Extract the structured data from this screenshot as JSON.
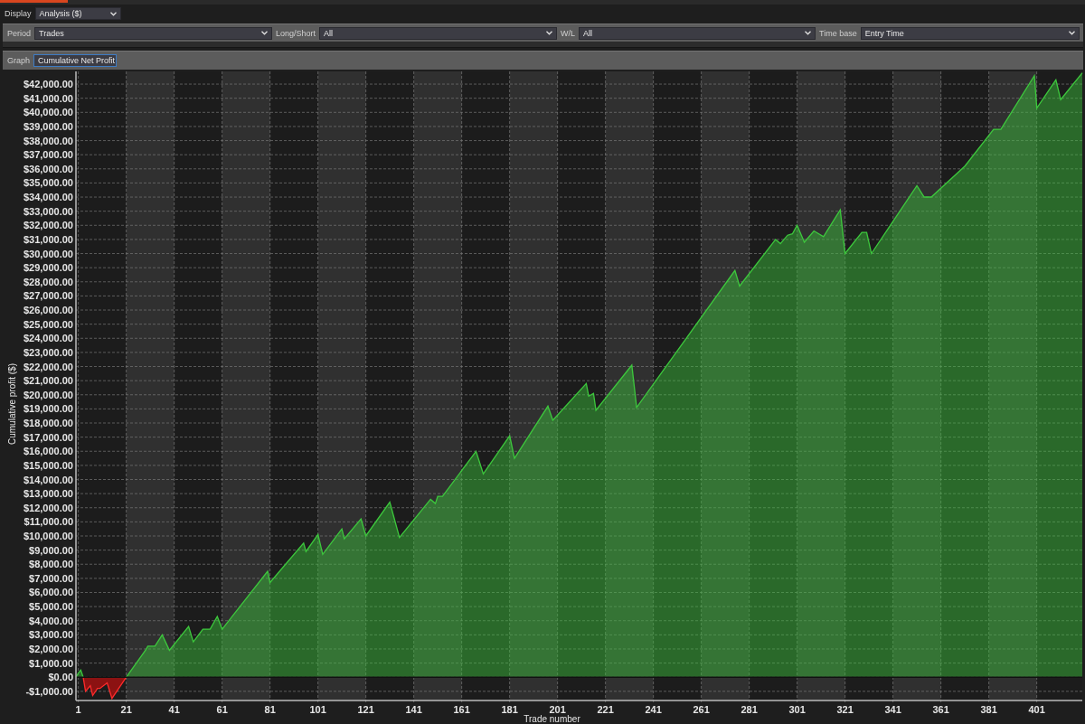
{
  "display": {
    "label": "Display",
    "value": "Analysis ($)"
  },
  "filters": [
    {
      "label": "Period",
      "value": "Trades"
    },
    {
      "label": "Long/Short",
      "value": "All"
    },
    {
      "label": "W/L",
      "value": "All"
    },
    {
      "label": "Time base",
      "value": "Entry Time"
    }
  ],
  "graph": {
    "label": "Graph",
    "value": "Cumulative Net Profit",
    "chart_data": {
      "type": "area",
      "grid": true,
      "xlabel": "Trade number",
      "ylabel": "Cumulative profit ($)",
      "xlim": [
        0,
        420
      ],
      "ylim": [
        -1650,
        42900
      ],
      "xticks": [
        1,
        21,
        41,
        61,
        81,
        101,
        121,
        141,
        161,
        181,
        201,
        221,
        241,
        261,
        281,
        301,
        321,
        341,
        361,
        381,
        401
      ],
      "yticks": [
        {
          "value": -1000,
          "label": "-$1,000.00"
        },
        {
          "value": 0,
          "label": "$0.00"
        },
        {
          "value": 1000,
          "label": "$1,000.00"
        },
        {
          "value": 2000,
          "label": "$2,000.00"
        },
        {
          "value": 3000,
          "label": "$3,000.00"
        },
        {
          "value": 4000,
          "label": "$4,000.00"
        },
        {
          "value": 5000,
          "label": "$5,000.00"
        },
        {
          "value": 6000,
          "label": "$6,000.00"
        },
        {
          "value": 7000,
          "label": "$7,000.00"
        },
        {
          "value": 8000,
          "label": "$8,000.00"
        },
        {
          "value": 9000,
          "label": "$9,000.00"
        },
        {
          "value": 10000,
          "label": "$10,000.00"
        },
        {
          "value": 11000,
          "label": "$11,000.00"
        },
        {
          "value": 12000,
          "label": "$12,000.00"
        },
        {
          "value": 13000,
          "label": "$13,000.00"
        },
        {
          "value": 14000,
          "label": "$14,000.00"
        },
        {
          "value": 15000,
          "label": "$15,000.00"
        },
        {
          "value": 16000,
          "label": "$16,000.00"
        },
        {
          "value": 17000,
          "label": "$17,000.00"
        },
        {
          "value": 18000,
          "label": "$18,000.00"
        },
        {
          "value": 19000,
          "label": "$19,000.00"
        },
        {
          "value": 20000,
          "label": "$20,000.00"
        },
        {
          "value": 21000,
          "label": "$21,000.00"
        },
        {
          "value": 22000,
          "label": "$22,000.00"
        },
        {
          "value": 23000,
          "label": "$23,000.00"
        },
        {
          "value": 24000,
          "label": "$24,000.00"
        },
        {
          "value": 25000,
          "label": "$25,000.00"
        },
        {
          "value": 26000,
          "label": "$26,000.00"
        },
        {
          "value": 27000,
          "label": "$27,000.00"
        },
        {
          "value": 28000,
          "label": "$28,000.00"
        },
        {
          "value": 29000,
          "label": "$29,000.00"
        },
        {
          "value": 30000,
          "label": "$30,000.00"
        },
        {
          "value": 31000,
          "label": "$31,000.00"
        },
        {
          "value": 32000,
          "label": "$32,000.00"
        },
        {
          "value": 33000,
          "label": "$33,000.00"
        },
        {
          "value": 34000,
          "label": "$34,000.00"
        },
        {
          "value": 35000,
          "label": "$35,000.00"
        },
        {
          "value": 36000,
          "label": "$36,000.00"
        },
        {
          "value": 37000,
          "label": "$37,000.00"
        },
        {
          "value": 38000,
          "label": "$38,000.00"
        },
        {
          "value": 39000,
          "label": "$39,000.00"
        },
        {
          "value": 40000,
          "label": "$40,000.00"
        },
        {
          "value": 41000,
          "label": "$41,000.00"
        },
        {
          "value": 42000,
          "label": "$42,000.00"
        }
      ],
      "x": [
        0,
        1,
        2,
        3,
        4,
        6,
        7,
        9,
        10,
        13,
        15,
        21,
        29,
        30,
        33,
        36,
        39,
        47,
        49,
        53,
        56,
        59,
        61,
        80,
        81,
        95,
        96,
        101,
        103,
        111,
        112,
        119,
        121,
        131,
        135,
        148,
        150,
        151,
        153,
        167,
        170,
        181,
        183,
        197,
        199,
        213,
        214,
        216,
        217,
        232,
        234,
        275,
        277,
        292,
        294,
        297,
        299,
        301,
        304,
        308,
        312,
        319,
        321,
        328,
        330,
        332,
        351,
        354,
        357,
        371,
        383,
        386,
        400,
        401,
        409,
        411,
        420
      ],
      "series": [
        {
          "color": "#3cc83c",
          "values": [
            0,
            300,
            500,
            0,
            -1000,
            -600,
            -1300,
            -800,
            -800,
            -400,
            -1500,
            0,
            1900,
            2200,
            2200,
            3000,
            1900,
            3600,
            2500,
            3400,
            3400,
            4300,
            3400,
            7500,
            6700,
            9500,
            8900,
            10100,
            8700,
            10500,
            9800,
            11200,
            10000,
            12400,
            9900,
            12600,
            12300,
            12800,
            12800,
            16000,
            14400,
            17100,
            15500,
            19200,
            18200,
            20800,
            19900,
            20100,
            18900,
            22100,
            19100,
            28800,
            27700,
            31000,
            30700,
            31300,
            31400,
            32000,
            30800,
            31600,
            31200,
            33100,
            30000,
            31500,
            31500,
            30000,
            34800,
            34000,
            34000,
            36200,
            38800,
            38800,
            42600,
            40300,
            42300,
            40900,
            42800
          ]
        }
      ]
    }
  }
}
